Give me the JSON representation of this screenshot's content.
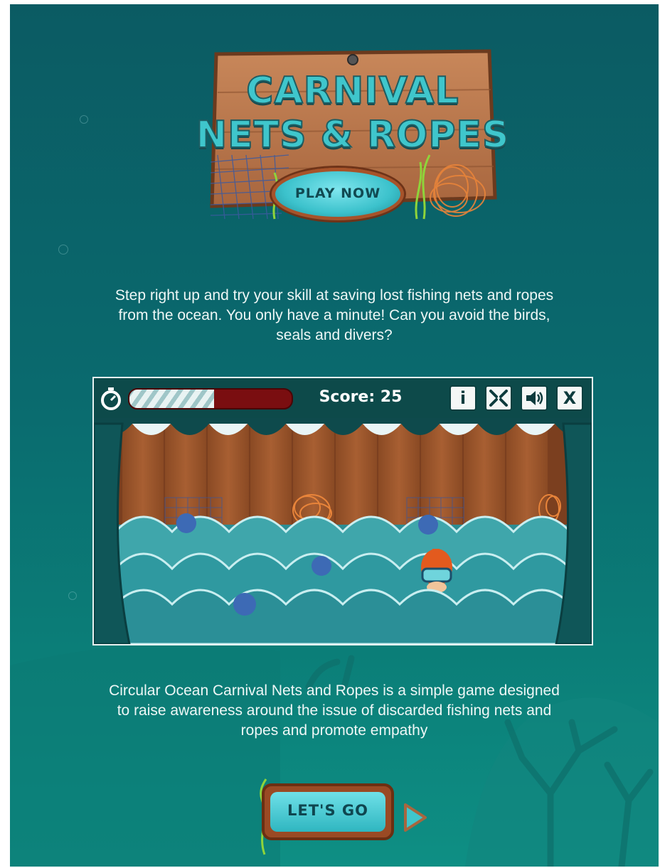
{
  "logo": {
    "title_line1": "CARNIVAL",
    "title_line2": "NETS & ROPES",
    "play_button": "PLAY NOW"
  },
  "intro_text": "Step right up and try your skill at saving lost fishing nets and ropes from the ocean. You only have a minute! Can you avoid the birds, seals and divers?",
  "game": {
    "timer_remaining": 0.52,
    "score_label": "Score: 25",
    "buttons": {
      "info": "i",
      "fullscreen": "fullscreen-icon",
      "sound": "speaker-icon",
      "close": "X"
    }
  },
  "about_text": "Circular Ocean Carnival Nets and Ropes is a simple game designed to raise awareness around the issue of discarded fishing nets and ropes and promote empathy",
  "cta": {
    "lets_go": "LET'S GO",
    "arrow_icon": "play-arrow-icon"
  },
  "colors": {
    "background": "#0a6a6e",
    "wood": "#b8764a",
    "accent_teal": "#3fc6cc",
    "timer_red": "#7a0e10"
  }
}
